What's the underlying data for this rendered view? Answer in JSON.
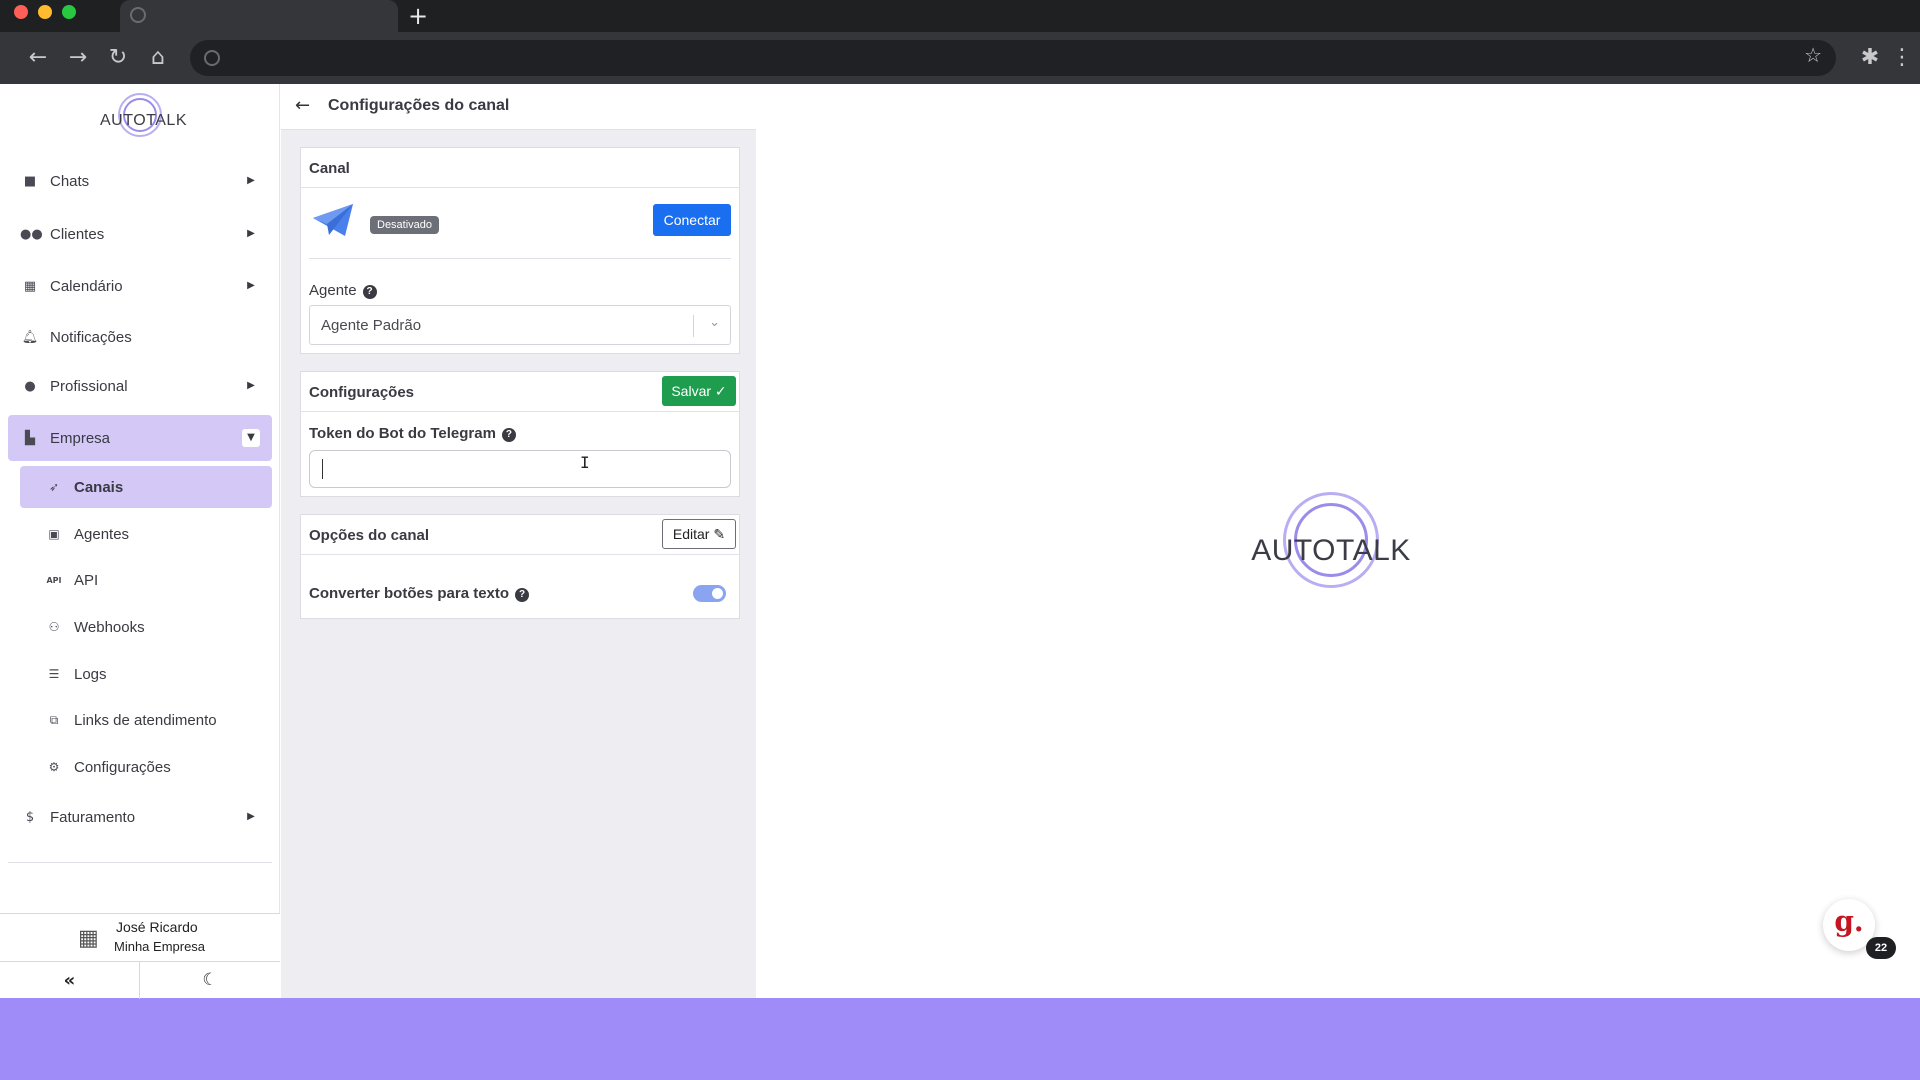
{
  "colors": {
    "accent": "#d4c8f7",
    "primary_button": "#1a6ef0",
    "success_button": "#1f9d4f",
    "footer_band": "#a08cf8",
    "telegram": "#4a80ec"
  },
  "browser": {
    "tab_icon": "globe-icon",
    "new_tab_label": "+",
    "url": ""
  },
  "sidebar": {
    "logo_text": "AUTOTALK",
    "items": [
      {
        "label": "Chats",
        "icon": "chat-bubble-icon",
        "has_caret": true
      },
      {
        "label": "Clientes",
        "icon": "users-icon",
        "has_caret": true
      },
      {
        "label": "Calendário",
        "icon": "calendar-icon",
        "has_caret": true
      },
      {
        "label": "Notificações",
        "icon": "bell-icon",
        "has_caret": false
      },
      {
        "label": "Profissional",
        "icon": "user-tie-icon",
        "has_caret": true
      },
      {
        "label": "Empresa",
        "icon": "building-icon",
        "has_caret": true,
        "active": true
      },
      {
        "label": "Faturamento",
        "icon": "dollar-icon",
        "has_caret": true
      }
    ],
    "sub_items": [
      {
        "label": "Canais",
        "icon": "rocket-icon",
        "active": true
      },
      {
        "label": "Agentes",
        "icon": "robot-icon"
      },
      {
        "label": "API",
        "icon": "api-icon"
      },
      {
        "label": "Webhooks",
        "icon": "webhook-icon"
      },
      {
        "label": "Logs",
        "icon": "list-icon"
      },
      {
        "label": "Links de atendimento",
        "icon": "external-link-icon"
      },
      {
        "label": "Configurações",
        "icon": "gear-icon"
      }
    ],
    "user": {
      "name": "José Ricardo",
      "company": "Minha Empresa"
    }
  },
  "panel": {
    "title": "Configurações do canal",
    "canal_card": {
      "title": "Canal",
      "status": "Desativado",
      "connect_label": "Conectar",
      "agent_label": "Agente",
      "agent_value": "Agente Padrão"
    },
    "config_card": {
      "title": "Configurações",
      "save_label": "Salvar ✓",
      "token_label": "Token do Bot do Telegram",
      "token_value": ""
    },
    "options_card": {
      "title": "Opções do canal",
      "edit_label": "Editar",
      "convert_label": "Converter botões para texto",
      "convert_enabled": true
    }
  },
  "right": {
    "logo_text": "AUTOTALK",
    "chat_widget_letter": "g.",
    "chat_widget_count": "22"
  }
}
